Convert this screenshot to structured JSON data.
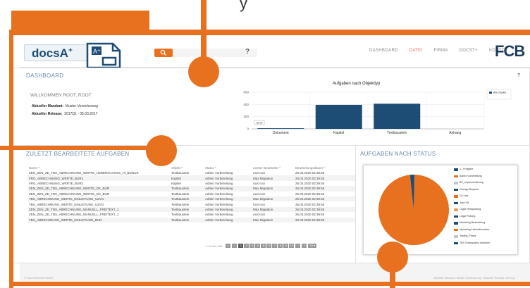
{
  "overlay_title": "y",
  "header": {
    "logo_text": "docsA",
    "logo_sup": "+",
    "search_placeholder": "",
    "help_mark": "?",
    "nav": [
      {
        "label": "DASHBOARD",
        "active": false
      },
      {
        "label": "DATEI",
        "active": true
      },
      {
        "label": "FIRMA",
        "active": false
      },
      {
        "label": "DOCST+",
        "active": false
      },
      {
        "label": "KONTO",
        "active": false
      }
    ],
    "brand": "FCB"
  },
  "dashboard": {
    "title": "DASHBOARD",
    "help": "?",
    "welcome": "WILLKOMMEN ROOT, ROOT",
    "mandant_label": "Aktueller Mandant:",
    "mandant_value": "Muster-Versicherung",
    "release_label": "Aktueller Release:",
    "release_value": "2017Q1 - 05.03.2017"
  },
  "chart_data": [
    {
      "type": "bar",
      "title": "Aufgaben nach Objekttyp",
      "categories": [
        "Dokument",
        "Kapitel",
        "Textbaustein",
        "Anhang"
      ],
      "series": [
        {
          "name": "Alle Objekte",
          "values": [
            10,
            393,
            412,
            0
          ]
        }
      ],
      "data_label": "32.00",
      "yticks": [
        "600",
        "400",
        "200",
        "0"
      ],
      "ylim": [
        0,
        600
      ],
      "color": "#1d4c75"
    },
    {
      "type": "pie",
      "title": "AUFGABEN NACH STATUS",
      "slices": [
        {
          "name": "1 - Freigabe",
          "value": 0,
          "color": "#1d4c75"
        },
        {
          "name": "Admin Vorbereitung",
          "value": 98,
          "color": "#e8711f"
        },
        {
          "name": "BC_Implementierung",
          "value": 0,
          "color": "#c7c7c7"
        },
        {
          "name": "Change Request",
          "value": 0,
          "color": "#1d4c75"
        },
        {
          "name": "Go Live",
          "value": 0,
          "color": "#e8711f"
        },
        {
          "name": "Jose Fix",
          "value": 2,
          "color": "#1d4c75"
        },
        {
          "name": "Legal Textsprufung",
          "value": 0,
          "color": "#e8a05f"
        },
        {
          "name": "Legal Prüfung",
          "value": 0,
          "color": "#1d4c75"
        },
        {
          "name": "Marketing Bearbeitung",
          "value": 0,
          "color": "#1d4c75"
        },
        {
          "name": "Marketing Lektor/Korrektur",
          "value": 0,
          "color": "#e8711f"
        },
        {
          "name": "Testing_Phase",
          "value": 0,
          "color": "#c7c7c7"
        },
        {
          "name": "TBS Textbaustein überführt",
          "value": 0,
          "color": "#1d4c75"
        }
      ]
    }
  ],
  "list_panel": {
    "title": "ZULETZT BEARBEITETE AUFGABEN",
    "columns": [
      "Name ^",
      "Objekt ^",
      "Status ^",
      "Letzter Bearbeiter ^",
      "Bearbeitungsdatum ^"
    ],
    "rows": [
      [
        "ZEN_ZEN_ZE_TBS_ABRECHNUNG_WERTE_UEBERSCHUSS_HI_BONUS",
        "Textbaustein",
        "Admin Vorbereitung",
        "root root",
        "26.03.2020 02:39:55"
      ],
      [
        "FRG_ABRECHNUNG_WERTE_BUR2",
        "Kapitel",
        "Admin Vorbereitung",
        "Max Migration",
        "26.03.2020 02:39:55"
      ],
      [
        "FRG_ABRECHNUNG_WERTE_BUR2",
        "Kapitel",
        "Admin Vorbereitung",
        "root root",
        "26.03.2020 02:39:55"
      ],
      [
        "ZEN_ZEN_ZE_TBS_ABRECHNUNG_WERTE_DK_BUR",
        "Textbaustein",
        "Admin Vorbereitung",
        "Max Migration",
        "26.03.2020 02:39:55"
      ],
      [
        "ZEN_ZEN_ZE_TBS_ABRECHNUNG_WERTE_DK_BUR",
        "Textbaustein",
        "Admin Vorbereitung",
        "root root",
        "26.03.2020 02:39:55"
      ],
      [
        "TBS_ABRECHNUNG_WERTE_EINLEITUNG_UZVG",
        "Textbaustein",
        "Admin Vorbereitung",
        "Max Migration",
        "26.03.2020 02:39:55"
      ],
      [
        "TBS_ABRECHNUNG_WERTE_EINLEITUNG_UZVG",
        "Textbaustein",
        "Admin Vorbereitung",
        "root root",
        "26.03.2020 02:39:55"
      ],
      [
        "ZEN_ZEN_ZE_TBS_ABRECHNUNG_MANUELL_FREITEXT_1",
        "Textbaustein",
        "Admin Vorbereitung",
        "Max Migration",
        "26.03.2020 02:39:55"
      ],
      [
        "ZEN_ZEN_ZE_TBS_ABRECHNUNG_MANUELL_FREITEXT_1",
        "Textbaustein",
        "Admin Vorbereitung",
        "root root",
        "26.03.2020 02:39:55"
      ],
      [
        "TBS_ABRECHNUNG_WERTE_EINLEITUNG_BUR",
        "Textbaustein",
        "Admin Vorbereitung",
        "Max Migration",
        "26.03.2020 02:39:55"
      ]
    ],
    "pager_info": "1-10 von 100",
    "pages": [
      "1",
      "2",
      "3",
      "4",
      "5",
      "6",
      "7",
      "8",
      "9",
      "10"
    ]
  },
  "footer": {
    "left": "© Docs Elements GmbH",
    "right": "Aktueller Mandant: Muster-Versicherung · Aktueller Release: 2017Q1"
  }
}
